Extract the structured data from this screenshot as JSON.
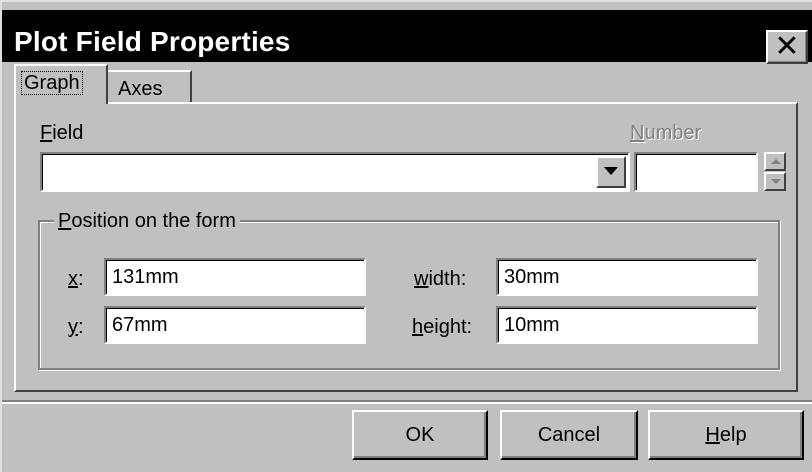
{
  "window": {
    "title": "Plot Field Properties",
    "close_glyph": "✕"
  },
  "tabs": [
    {
      "label": "Graph",
      "selected": true
    },
    {
      "label": "Axes",
      "selected": false
    }
  ],
  "field": {
    "label_prefix": "F",
    "label_rest": "ield",
    "value": "",
    "dropdown_icon": "chevron-down-icon"
  },
  "number": {
    "label_prefix": "N",
    "label_rest": "umber",
    "value": "",
    "enabled": false
  },
  "position_group": {
    "title_prefix": "P",
    "title_rest": "osition on the form",
    "x": {
      "label_prefix": "x",
      "label_rest": ":",
      "value": "131mm"
    },
    "y": {
      "label_prefix": "y",
      "label_rest": ":",
      "value": "67mm"
    },
    "width": {
      "label_prefix": "w",
      "label_rest": "idth:",
      "value": "30mm"
    },
    "height": {
      "label_prefix": "h",
      "label_rest": "eight:",
      "value": "10mm"
    }
  },
  "buttons": {
    "ok": "OK",
    "cancel": "Cancel",
    "help_prefix": "H",
    "help_rest": "elp"
  },
  "colors": {
    "dialog_face": "#c0c0c0",
    "titlebar": "#000000",
    "title_text": "#ffffff"
  }
}
